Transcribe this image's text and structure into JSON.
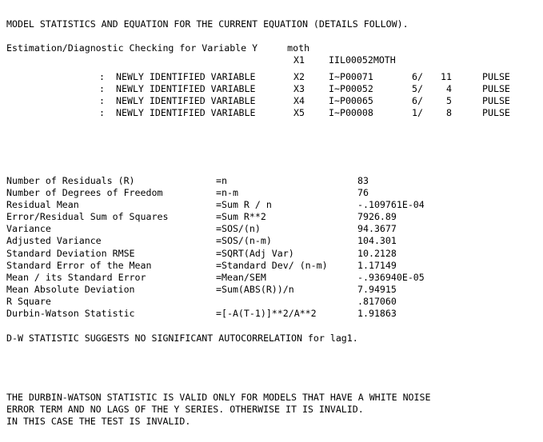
{
  "report": {
    "title_line": "MODEL STATISTICS AND EQUATION FOR THE CURRENT EQUATION (DETAILS FOLLOW).",
    "estimation_header": {
      "label": "Estimation/Diagnostic Checking for Variable",
      "slot": "Y",
      "name": "moth"
    },
    "x1_row": {
      "slot": "X1",
      "name": "IIL00052MOTH"
    },
    "variable_rows": [
      {
        "marker": ":",
        "description": "NEWLY IDENTIFIED VARIABLE",
        "slot": "X2",
        "name": "I~P00071",
        "num1": "6/",
        "num2": "11",
        "type": "PULSE"
      },
      {
        "marker": ":",
        "description": "NEWLY IDENTIFIED VARIABLE",
        "slot": "X3",
        "name": "I~P00052",
        "num1": "5/",
        "num2": "4",
        "type": "PULSE"
      },
      {
        "marker": ":",
        "description": "NEWLY IDENTIFIED VARIABLE",
        "slot": "X4",
        "name": "I~P00065",
        "num1": "6/",
        "num2": "5",
        "type": "PULSE"
      },
      {
        "marker": ":",
        "description": "NEWLY IDENTIFIED VARIABLE",
        "slot": "X5",
        "name": "I~P00008",
        "num1": "1/",
        "num2": "8",
        "type": "PULSE"
      }
    ],
    "statistics": [
      {
        "label": "Number of Residuals (R)",
        "formula": "=n",
        "value": "83"
      },
      {
        "label": "Number of Degrees of Freedom",
        "formula": "=n-m",
        "value": "76"
      },
      {
        "label": "Residual Mean",
        "formula": "=Sum R / n",
        "value": "-.109761E-04"
      },
      {
        "label": "Error/Residual Sum of Squares",
        "formula": "=Sum R**2",
        "value": "7926.89"
      },
      {
        "label": "Variance",
        "formula": "=SOS/(n)",
        "value": "94.3677"
      },
      {
        "label": "Adjusted Variance",
        "formula": "=SOS/(n-m)",
        "value": "104.301"
      },
      {
        "label": "Standard Deviation RMSE",
        "formula": "=SQRT(Adj Var)",
        "value": "10.2128"
      },
      {
        "label": "Standard Error of the Mean",
        "formula": "=Standard Dev/ (n-m)",
        "value": "1.17149"
      },
      {
        "label": "Mean / its Standard Error",
        "formula": "=Mean/SEM",
        "value": "-.936940E-05"
      },
      {
        "label": "Mean Absolute Deviation",
        "formula": "=Sum(ABS(R))/n",
        "value": "7.94915"
      },
      {
        "label": "R Square",
        "formula": "",
        "value": ".817060"
      },
      {
        "label": "Durbin-Watson Statistic",
        "formula": "=[-A(T-1)]**2/A**2",
        "value": "1.91863"
      }
    ],
    "dw_note": "D-W STATISTIC SUGGESTS NO SIGNIFICANT AUTOCORRELATION for lag1.",
    "validity_note_lines": [
      "THE DURBIN-WATSON STATISTIC IS VALID ONLY FOR MODELS THAT HAVE A WHITE NOISE",
      "ERROR TERM AND NO LAGS OF THE Y SERIES. OTHERWISE IT IS INVALID.",
      "IN THIS CASE THE TEST IS INVALID."
    ]
  },
  "colors": {
    "background": "#ffffff",
    "text": "#000000"
  }
}
